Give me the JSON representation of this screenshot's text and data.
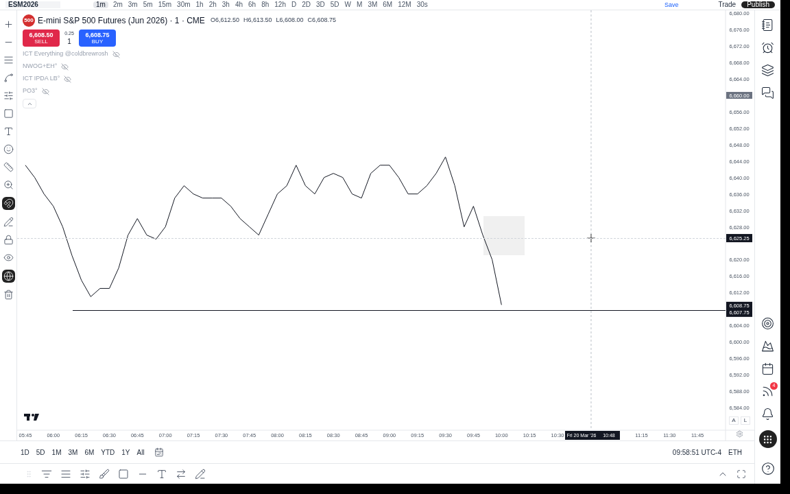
{
  "top_bar": {
    "symbol": "ESM2026",
    "timeframes": [
      {
        "label": "1m",
        "selected": true
      },
      {
        "label": "2m",
        "selected": false
      },
      {
        "label": "3m",
        "selected": false
      },
      {
        "label": "5m",
        "selected": false
      },
      {
        "label": "15m",
        "selected": false
      },
      {
        "label": "30m",
        "selected": false
      },
      {
        "label": "1h",
        "selected": false
      },
      {
        "label": "2h",
        "selected": false
      },
      {
        "label": "3h",
        "selected": false
      },
      {
        "label": "4h",
        "selected": false
      },
      {
        "label": "6h",
        "selected": false
      },
      {
        "label": "8h",
        "selected": false
      },
      {
        "label": "12h",
        "selected": false
      },
      {
        "label": "D",
        "selected": false
      },
      {
        "label": "2D",
        "selected": false
      },
      {
        "label": "3D",
        "selected": false
      },
      {
        "label": "5D",
        "selected": false
      },
      {
        "label": "W",
        "selected": false
      },
      {
        "label": "M",
        "selected": false
      },
      {
        "label": "3M",
        "selected": false
      },
      {
        "label": "6M",
        "selected": false
      },
      {
        "label": "12M",
        "selected": false
      },
      {
        "label": "30s",
        "selected": false
      }
    ],
    "save": "Save",
    "trade": "Trade",
    "publish": "Publish"
  },
  "legend": {
    "logo_text": "500",
    "title": "E-mini S&P 500 Futures (Jun 2026) · 1 · CME",
    "ohlc": [
      "O6,612.50",
      "H6,613.50",
      "L6,608.00",
      "C6,608.75"
    ],
    "sell": {
      "price": "6,608.50",
      "label": "SELL"
    },
    "spread": "0.25",
    "quantity": "1",
    "buy": {
      "price": "6,608.75",
      "label": "BUY"
    },
    "indicators": [
      {
        "name": "ICT Everything @coldbrewrosh",
        "hidden": true
      },
      {
        "name": "NWOG+EH°",
        "hidden": true
      },
      {
        "name": "ICT IPDA LB°",
        "hidden": true
      },
      {
        "name": "PO3°",
        "hidden": true
      }
    ]
  },
  "chart": {
    "chart_data": {
      "type": "line",
      "categories": [
        "05:45",
        null,
        null,
        "06:00",
        null,
        null,
        "06:15",
        null,
        null,
        "06:30",
        null,
        null,
        "06:45",
        null,
        null,
        "07:00",
        null,
        null,
        "07:15",
        null,
        null,
        "07:30",
        null,
        null,
        "07:45",
        null,
        null,
        "08:00",
        null,
        null,
        "08:15",
        null,
        null,
        "08:30",
        null,
        null,
        "08:45",
        null,
        null,
        "09:00",
        null,
        null,
        "09:15",
        null,
        null,
        "09:30",
        null,
        null,
        "09:45",
        null,
        null,
        "10:00",
        null,
        null,
        "10:15",
        null,
        null,
        "10:30",
        null,
        null,
        null,
        null,
        null,
        null,
        null,
        null,
        "11:15",
        null,
        null,
        "11:30",
        null,
        null,
        "11:45",
        null
      ],
      "series": [
        {
          "color": "#131722",
          "values": [
            6643,
            6640,
            6636,
            6633,
            6628,
            6621,
            6615,
            6611,
            6613,
            6613,
            6618,
            6626,
            6630,
            6626,
            6625,
            6628,
            6635,
            6638,
            6636,
            6635,
            6635,
            6635,
            6633,
            6630,
            6628,
            6626,
            6631,
            6636,
            6638,
            6643,
            6638,
            6636,
            6640,
            6641,
            6640,
            6636,
            6635,
            6641,
            6643,
            6643,
            6640,
            6636,
            6636,
            6638,
            6641,
            6645,
            6638,
            6628,
            6633,
            6626,
            6620,
            6609,
            null,
            null,
            null,
            null,
            null,
            null,
            null,
            null,
            null,
            null,
            null,
            null,
            null,
            null,
            null,
            null,
            null,
            null,
            null,
            null,
            null,
            null
          ]
        }
      ],
      "ylim": [
        6578.5,
        6680.7
      ],
      "yticks": [
        {
          "value": 6680,
          "label": "6,680.00"
        },
        {
          "value": 6676,
          "label": "6,676.00"
        },
        {
          "value": 6672,
          "label": "6,672.00"
        },
        {
          "value": 6668,
          "label": "6,668.00"
        },
        {
          "value": 6664,
          "label": "6,664.00"
        },
        {
          "value": 6656,
          "label": "6,656.00"
        },
        {
          "value": 6652,
          "label": "6,652.00"
        },
        {
          "value": 6648,
          "label": "6,648.00"
        },
        {
          "value": 6644,
          "label": "6,644.00"
        },
        {
          "value": 6640,
          "label": "6,640.00"
        },
        {
          "value": 6636,
          "label": "6,636.00"
        },
        {
          "value": 6632,
          "label": "6,632.00"
        },
        {
          "value": 6628,
          "label": "6,628.00"
        },
        {
          "value": 6620,
          "label": "6,620.00"
        },
        {
          "value": 6616,
          "label": "6,616.00"
        },
        {
          "value": 6612,
          "label": "6,612.00"
        },
        {
          "value": 6604,
          "label": "6,604.00"
        },
        {
          "value": 6600,
          "label": "6,600.00"
        },
        {
          "value": 6596,
          "label": "6,596.00"
        },
        {
          "value": 6592,
          "label": "6,592.00"
        },
        {
          "value": 6588,
          "label": "6,588.00"
        },
        {
          "value": 6584,
          "label": "6,584.00"
        }
      ]
    },
    "crosshair": {
      "date": "Fri 20 Mar '26",
      "time": "10:48",
      "price": "6,625.25"
    },
    "alert_marker": "6,660.00",
    "last_price_markers": [
      "6,608.75",
      "6,607.75"
    ],
    "auto_button": "A",
    "log_button": "L"
  },
  "range_bar": {
    "ranges": [
      "1D",
      "5D",
      "1M",
      "3M",
      "6M",
      "YTD",
      "1Y",
      "All"
    ],
    "clock": "09:58:51 UTC-4",
    "session": "ETH"
  },
  "right_sidebar": {
    "badge": "4"
  }
}
